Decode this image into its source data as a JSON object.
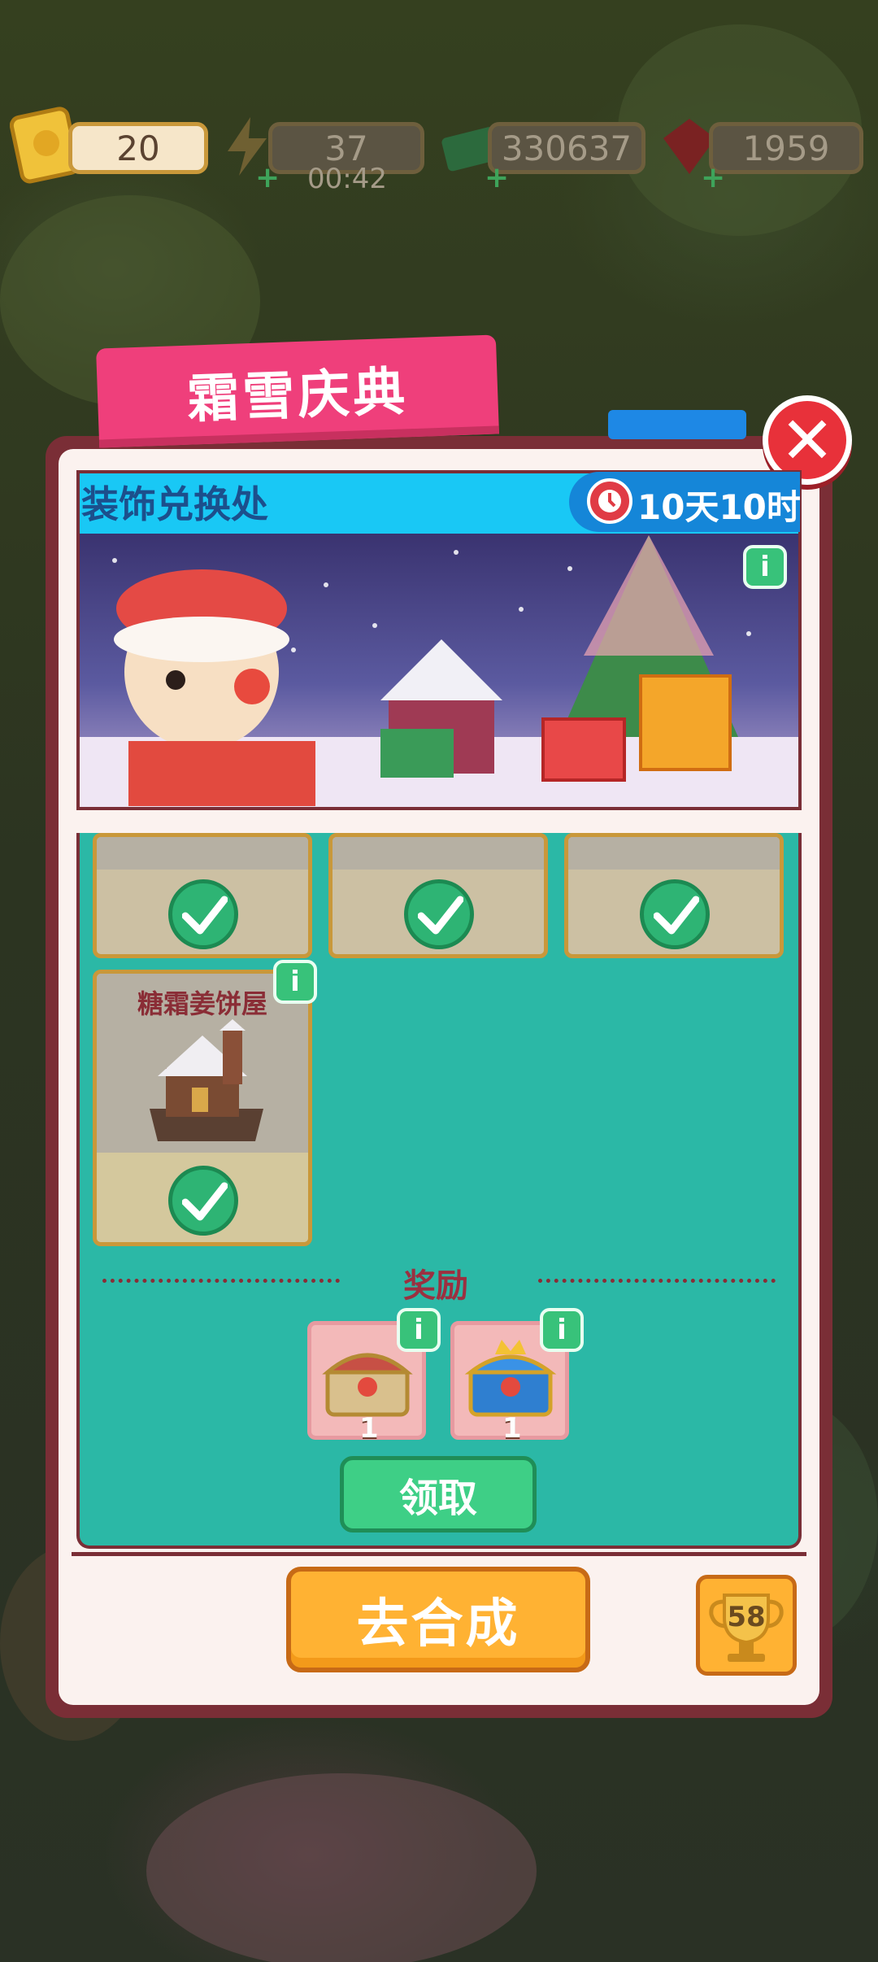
{
  "resources": {
    "tickets": "20",
    "energy": "37",
    "energy_timer": "00:42",
    "cash": "330637",
    "gems": "1959"
  },
  "event": {
    "title": "霜雪庆典",
    "section": "装饰兑换处",
    "remaining": "10天10时"
  },
  "items": [
    {
      "title": "",
      "claimed": true
    },
    {
      "title": "",
      "claimed": true
    },
    {
      "title": "",
      "claimed": true
    },
    {
      "title": "糖霜姜饼屋",
      "claimed": true
    }
  ],
  "rewards": {
    "label": "奖励",
    "list": [
      {
        "icon": "treasure-chest-icon",
        "count": "1"
      },
      {
        "icon": "crown-chest-icon",
        "count": "1"
      }
    ],
    "claim_label": "领取"
  },
  "footer": {
    "go_label": "去合成",
    "trophy_count": "58"
  },
  "info_label": "i",
  "close_label": "✕"
}
